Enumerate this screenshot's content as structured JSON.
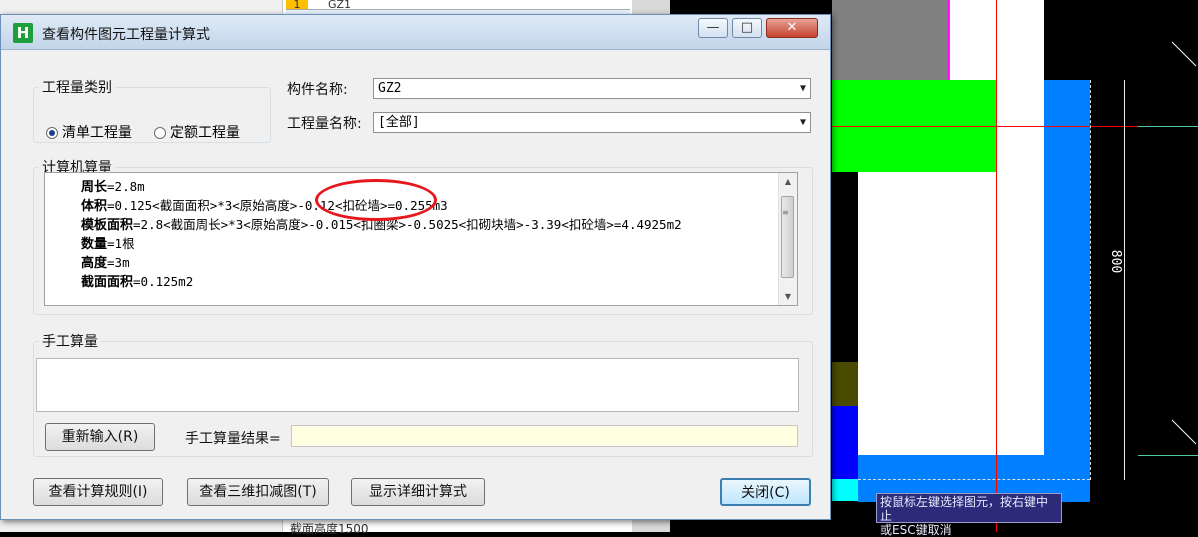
{
  "background": {
    "row_number": "1",
    "row_value": "GZ1",
    "footer_text": "截面高度1500",
    "dimension_label": "800",
    "status_tip_line1": "按鼠标左键选择图元，按右键中止",
    "status_tip_line2": "或ESC键取消"
  },
  "dialog": {
    "title": "查看构件图元工程量计算式",
    "icon_glyph": "H",
    "minimize_glyph": "—",
    "maximize_glyph": "□",
    "close_glyph": "✕"
  },
  "quantity_type": {
    "legend": "工程量类别",
    "options": [
      {
        "label": "清单工程量",
        "selected": true
      },
      {
        "label": "定额工程量",
        "selected": false
      }
    ]
  },
  "component": {
    "name_label": "构件名称:",
    "name_value": "GZ2",
    "qty_label": "工程量名称:",
    "qty_value": "[全部]"
  },
  "computer_calc": {
    "legend": "计算机算量",
    "lines": [
      {
        "name": "周长",
        "expr": "=2.8m"
      },
      {
        "name": "体积",
        "expr": "=0.125<截面面积>*3<原始高度>-0.12<扣砼墙>=0.255m3"
      },
      {
        "name": "模板面积",
        "expr": "=2.8<截面周长>*3<原始高度>-0.015<扣圈梁>-0.5025<扣砌块墙>-3.39<扣砼墙>=4.4925m2"
      },
      {
        "name": "数量",
        "expr": "=1根"
      },
      {
        "name": "高度",
        "expr": "=3m"
      },
      {
        "name": "截面面积",
        "expr": "=0.125m2"
      }
    ]
  },
  "manual_calc": {
    "legend": "手工算量",
    "reinput_label": "重新输入(R)",
    "result_label": "手工算量结果="
  },
  "buttons": {
    "rules": "查看计算规则(I)",
    "view3d": "查看三维扣减图(T)",
    "detail": "显示详细计算式",
    "close": "关闭(C)"
  },
  "colors": {
    "green": "#00ff00",
    "blue": "#0080ff",
    "deep_blue": "#0000ff",
    "cyan": "#00ffff",
    "olive": "#4a4a00",
    "gray": "#808080",
    "magenta_line": "#ff00ff",
    "red_line": "#ff0000"
  }
}
